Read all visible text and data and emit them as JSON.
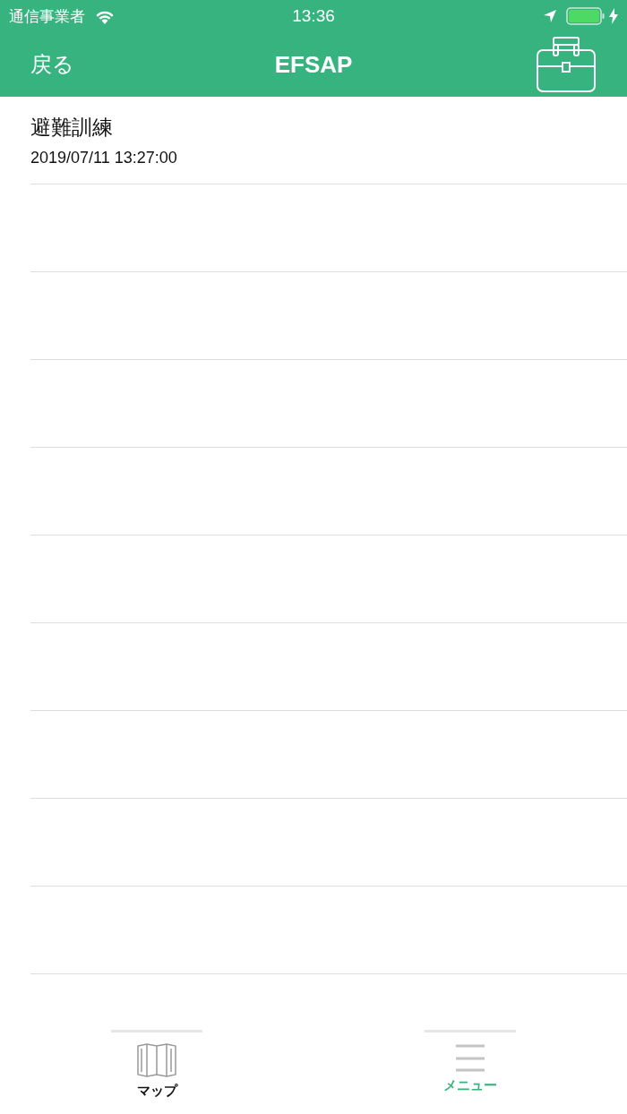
{
  "status_bar": {
    "carrier": "通信事業者",
    "time": "13:36"
  },
  "nav_bar": {
    "back": "戻る",
    "title": "EFSAP"
  },
  "list": {
    "items": [
      {
        "title": "避難訓練",
        "date": "2019/07/11 13:27:00"
      }
    ]
  },
  "tab_bar": {
    "tabs": [
      {
        "kind": "map",
        "label": "マップ",
        "selected": false
      },
      {
        "kind": "menu",
        "label": "メニュー",
        "selected": true
      }
    ]
  }
}
